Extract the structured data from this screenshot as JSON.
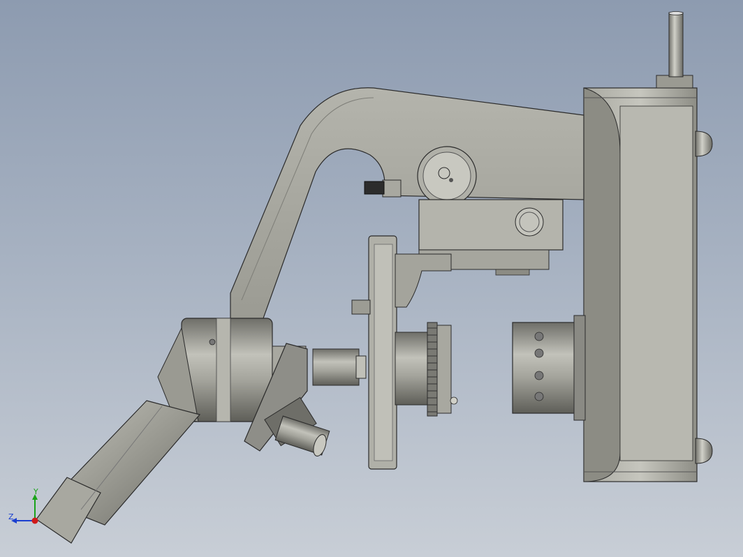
{
  "viewport": {
    "background_top": "#8d9bb0",
    "background_bottom": "#c8ced6",
    "model_part_color": "#9c9c94",
    "edge_color": "#2b2b2b"
  },
  "triad": {
    "y_label": "Y",
    "z_label": "Z",
    "y_color": "#1aa31a",
    "z_color": "#1a3fd0",
    "origin_color": "#d01a1a"
  }
}
